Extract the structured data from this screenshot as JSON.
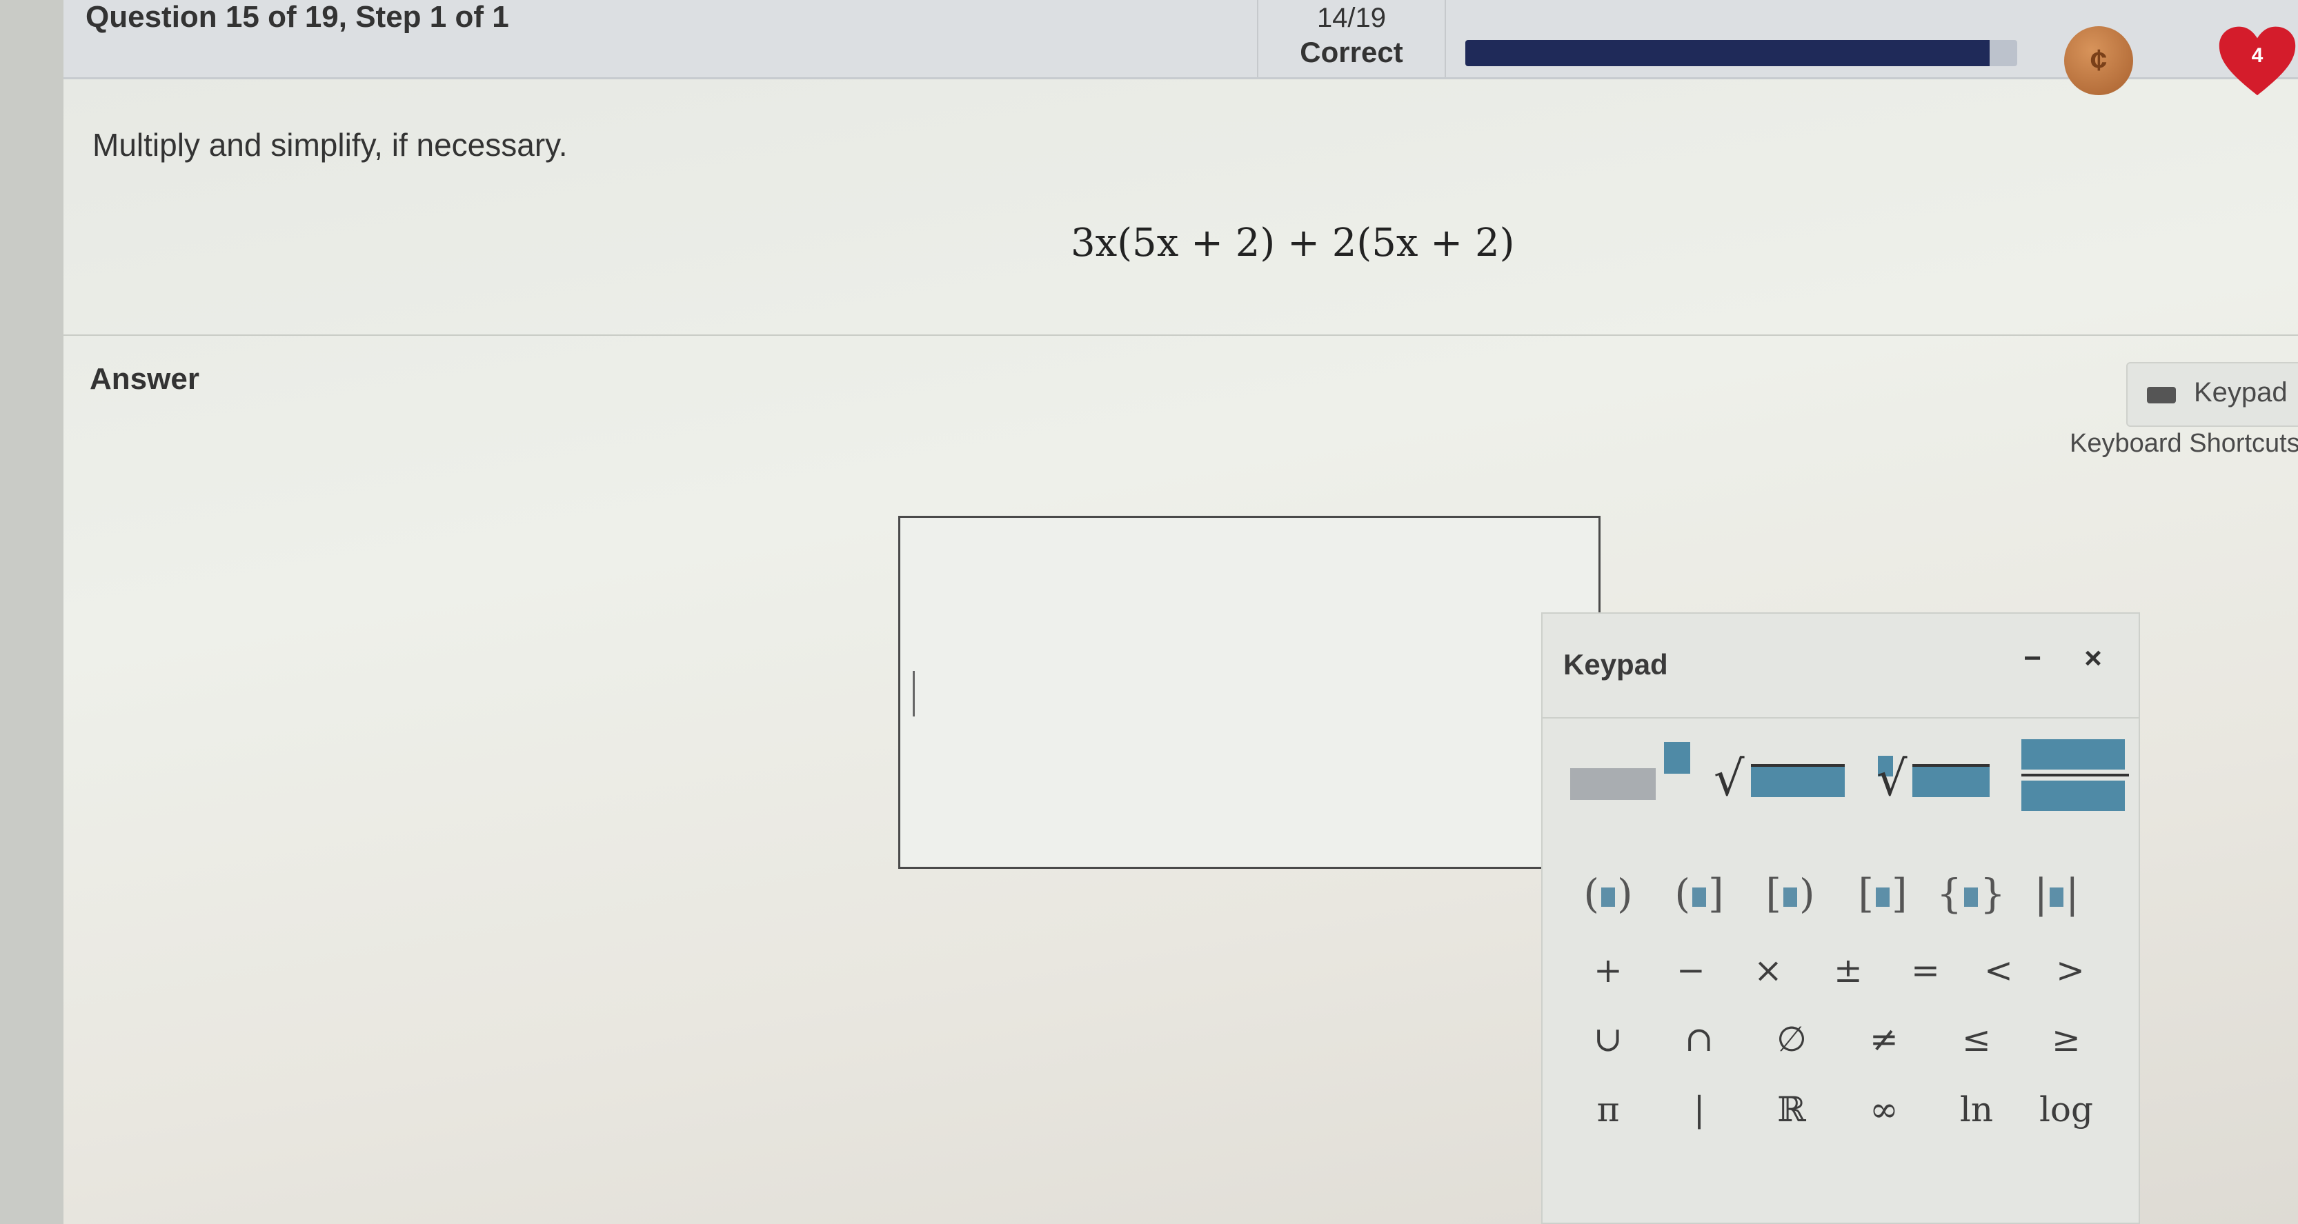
{
  "header": {
    "question_title": "Question 15 of 19, Step 1 of 1",
    "score": "14/19",
    "score_status": "Correct",
    "progress_fraction": 0.95,
    "progress_color": "#1f2a59",
    "coin_icon": "coin-icon",
    "hearts_count": "4",
    "heart_color": "#d41c2b"
  },
  "problem": {
    "instruction": "Multiply and simplify, if necessary.",
    "expression": "3x(5x + 2) + 2(5x + 2)"
  },
  "answer": {
    "label": "Answer",
    "keypad_button": "Keypad",
    "keyboard_shortcuts": "Keyboard Shortcuts",
    "input_value": ""
  },
  "keypad": {
    "title": "Keypad",
    "minimize_label": "−",
    "close_label": "×",
    "templates": [
      "exponent",
      "square-root",
      "nth-root",
      "fraction"
    ],
    "brackets": [
      "(□)",
      "(□]",
      "[□)",
      "[□]",
      "{□}",
      "|□|"
    ],
    "operators": [
      "+",
      "−",
      "×",
      "±",
      "=",
      "<",
      ">"
    ],
    "sets": [
      "∪",
      "∩",
      "∅",
      "≠",
      "≤",
      "≥"
    ],
    "constants": [
      "π",
      "|",
      "ℝ",
      "∞",
      "ln",
      "log"
    ]
  }
}
